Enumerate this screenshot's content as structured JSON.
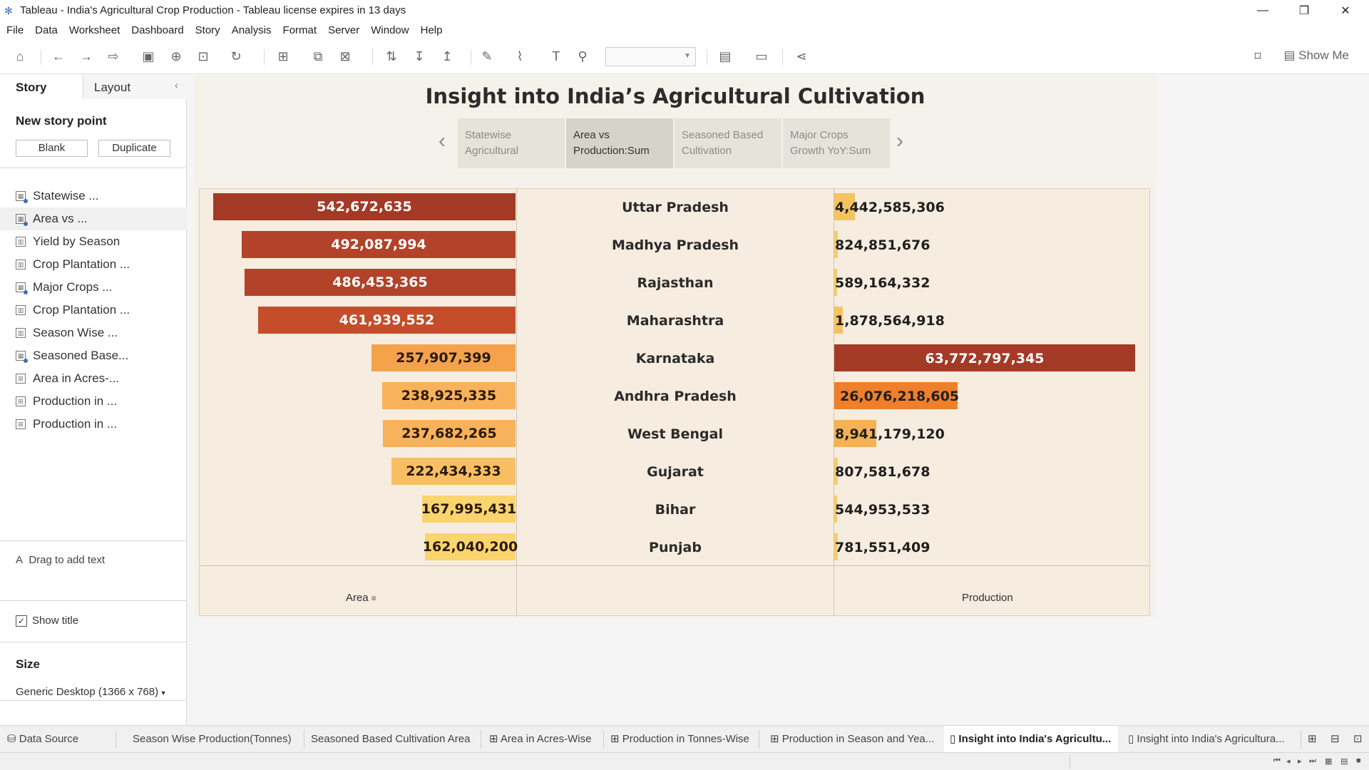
{
  "window": {
    "title": "Tableau - India's Agricultural Crop Production - Tableau license expires in 13 days"
  },
  "menu": [
    "File",
    "Data",
    "Worksheet",
    "Dashboard",
    "Story",
    "Analysis",
    "Format",
    "Server",
    "Window",
    "Help"
  ],
  "toolbar": {
    "show_me": "Show Me"
  },
  "left_pane": {
    "tab_story": "Story",
    "tab_layout": "Layout",
    "new_story_point": "New story point",
    "blank_button": "Blank",
    "duplicate_button": "Duplicate",
    "items": [
      {
        "label": "Statewise ...",
        "type": "dashboard"
      },
      {
        "label": "Area vs ...",
        "type": "dashboard"
      },
      {
        "label": "Yield by Season",
        "type": "sheet"
      },
      {
        "label": "Crop Plantation ...",
        "type": "sheet"
      },
      {
        "label": "Major Crops ...",
        "type": "dashboard"
      },
      {
        "label": "Crop Plantation ...",
        "type": "sheet"
      },
      {
        "label": "Season Wise ...",
        "type": "sheet"
      },
      {
        "label": "Seasoned Base...",
        "type": "dashboard"
      },
      {
        "label": "Area in Acres-...",
        "type": "table"
      },
      {
        "label": "Production in ...",
        "type": "table"
      },
      {
        "label": "Production in ...",
        "type": "table"
      }
    ],
    "drag_text": "Drag to add text",
    "show_title": "Show title",
    "size_label": "Size",
    "size_value": "Generic Desktop (1366 x 768)"
  },
  "story": {
    "title": "Insight into India’s Agricultural Cultivation",
    "points": [
      {
        "line1": "Statewise",
        "line2": "Agricultural"
      },
      {
        "line1": "Area vs",
        "line2": "Production:Sum"
      },
      {
        "line1": "Seasoned Based",
        "line2": "Cultivation"
      },
      {
        "line1": "Major Crops",
        "line2": "Growth YoY:Sum"
      }
    ]
  },
  "axes": {
    "area": "Area",
    "production": "Production"
  },
  "chart_data": {
    "type": "bar",
    "categories": [
      "Uttar Pradesh",
      "Madhya Pradesh",
      "Rajasthan",
      "Maharashtra",
      "Karnataka",
      "Andhra Pradesh",
      "West Bengal",
      "Gujarat",
      "Bihar",
      "Punjab"
    ],
    "series": [
      {
        "name": "Area",
        "values": [
          542672635,
          492087994,
          486453365,
          461939552,
          257907399,
          238925335,
          237682265,
          222434333,
          167995431,
          162040200
        ]
      },
      {
        "name": "Production",
        "values": [
          4442585306,
          824851676,
          589164332,
          1878564918,
          63772797345,
          26076218605,
          8941179120,
          807581678,
          544953533,
          781551409
        ]
      }
    ],
    "area_labels": [
      "542,672,635",
      "492,087,994",
      "486,453,365",
      "461,939,552",
      "257,907,399",
      "238,925,335",
      "237,682,265",
      "222,434,333",
      "167,995,431",
      "162,040,200"
    ],
    "production_labels": [
      "4,442,585,306",
      "824,851,676",
      "589,164,332",
      "1,878,564,918",
      "63,772,797,345",
      "26,076,218,605",
      "8,941,179,120",
      "807,581,678",
      "544,953,533",
      "781,551,409"
    ],
    "area_colors": [
      "#a33a26",
      "#b2432a",
      "#b2432a",
      "#c44e2a",
      "#f4a24c",
      "#f7b25b",
      "#f7b25b",
      "#f8bf62",
      "#fad56e",
      "#fad56e"
    ],
    "production_colors": [
      "#f6c35f",
      "#f8cd66",
      "#f8cd66",
      "#f6c35f",
      "#a33a26",
      "#ef7f2a",
      "#f4b254",
      "#f8cd66",
      "#f8cd66",
      "#f8cd66"
    ]
  },
  "sheet_tabs": [
    "Data Source",
    "Season Wise Production(Tonnes)",
    "Seasoned Based Cultivation Area",
    "Area in Acres-Wise",
    "Production in Tonnes-Wise",
    "Production in Season and Yea...",
    "Insight into India's Agricultu...",
    "Insight into India's Agricultura..."
  ]
}
